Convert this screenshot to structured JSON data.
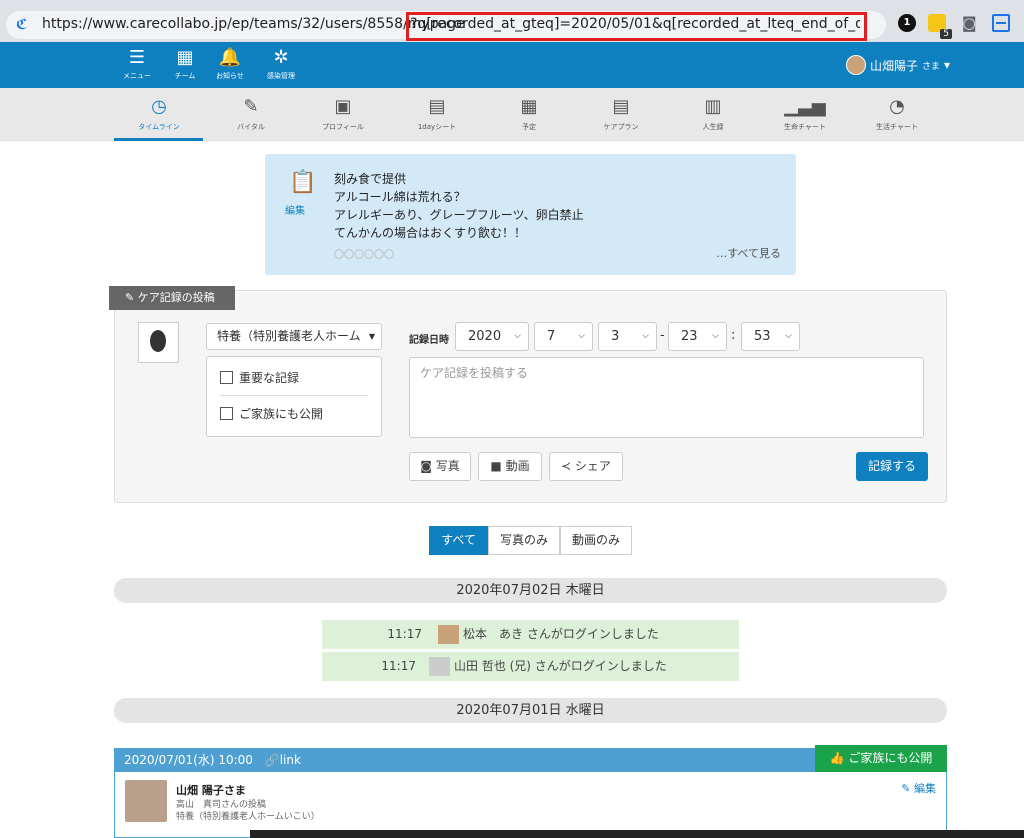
{
  "browser": {
    "url_host": "https://www.carecollabo.jp",
    "url_path": "/ep/teams/32/users/8558/mypage",
    "url_query": "?q[recorded_at_gteq]=2020/05/01&q[recorded_at_lteq_end_of_day]=202...",
    "ext_badge_1": "1",
    "ext_badge_2": "5"
  },
  "top_nav": {
    "items": [
      {
        "label": "メニュー",
        "icon": "☰"
      },
      {
        "label": "チーム",
        "icon": "▦"
      },
      {
        "label": "お知らせ",
        "icon": "🔔"
      },
      {
        "label": "感染管理",
        "icon": "✲"
      }
    ],
    "user_name": "山畑陽子",
    "user_suffix": "さま",
    "user_caret": "▾"
  },
  "tabs": [
    {
      "label": "タイムライン",
      "icon": "◷"
    },
    {
      "label": "バイタル",
      "icon": "✎"
    },
    {
      "label": "プロフィール",
      "icon": "▣"
    },
    {
      "label": "1dayシート",
      "icon": "▤"
    },
    {
      "label": "予定",
      "icon": "▦"
    },
    {
      "label": "ケアプラン",
      "icon": "▤"
    },
    {
      "label": "人生録",
      "icon": "▥"
    },
    {
      "label": "生命チャート",
      "icon": "▁▃▅"
    },
    {
      "label": "生活チャート",
      "icon": "◔"
    }
  ],
  "notice": {
    "edit_label": "編集",
    "lines": [
      "刻み食で提供",
      "アルコール綿は荒れる？",
      "アレルギーあり、グレープフルーツ、卵白禁止",
      "てんかんの場合はおくすり飲む！！"
    ],
    "faded": "〇〇〇〇〇〇",
    "more": "…すべて見る"
  },
  "post": {
    "tab_label": "ケア記録の投稿",
    "facility": "特養（特別養護老人ホーム",
    "important_label": "重要な記録",
    "family_label": "ご家族にも公開",
    "date_label": "記録日時",
    "year": "2020",
    "month": "7",
    "day": "3",
    "hour": "23",
    "minute": "53",
    "date_sep": "-",
    "time_sep": ":",
    "placeholder": "ケア記録を投稿する",
    "photo_label": "写真",
    "video_label": "動画",
    "share_label": "シェア",
    "submit_label": "記録する"
  },
  "filters": [
    "すべて",
    "写真のみ",
    "動画のみ"
  ],
  "timeline": {
    "day1": "2020年07月02日 木曜日",
    "logins": [
      {
        "time": "11:17",
        "message": "松本　あき さんがログインしました"
      },
      {
        "time": "11:17",
        "message": "山田 哲也 (兄) さんがログインしました"
      }
    ],
    "day2": "2020年07月01日 水曜日",
    "entry": {
      "datetime": "2020/07/01(水) 10:00",
      "link": "link",
      "family_badge": "ご家族にも公開",
      "name": "山畑 陽子さま",
      "poster": "高山　真司さんの投稿",
      "facility": "特養（特別養護老人ホームいこい）",
      "edit": "編集"
    }
  },
  "colors": {
    "primary": "#0e7fbf",
    "highlight": "#e02020",
    "notice_bg": "#d4e9f7",
    "login_bg": "#ddf0d8",
    "family_green": "#1aa34a"
  }
}
